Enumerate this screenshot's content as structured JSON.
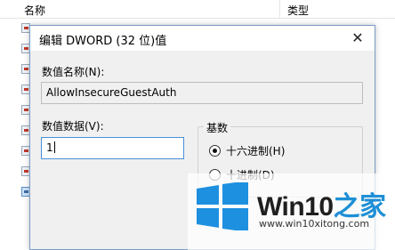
{
  "list": {
    "header_name": "名称",
    "header_type": "类型"
  },
  "dialog": {
    "title": "编辑 DWORD (32 位)值",
    "value_name_label": "数值名称(N):",
    "value_name": "AllowInsecureGuestAuth",
    "value_data_label": "数值数据(V):",
    "value_data": "1",
    "base_label": "基数",
    "base_options": [
      {
        "label": "十六进制(H)",
        "selected": true
      },
      {
        "label": "十进制(D)",
        "selected": false
      }
    ]
  },
  "watermark": {
    "brand_prefix": "Win10",
    "brand_suffix": "之家",
    "url": "www.win10xitong.com",
    "colors": {
      "accent": "#1e8fd6",
      "logo": "#1e90e0"
    }
  }
}
